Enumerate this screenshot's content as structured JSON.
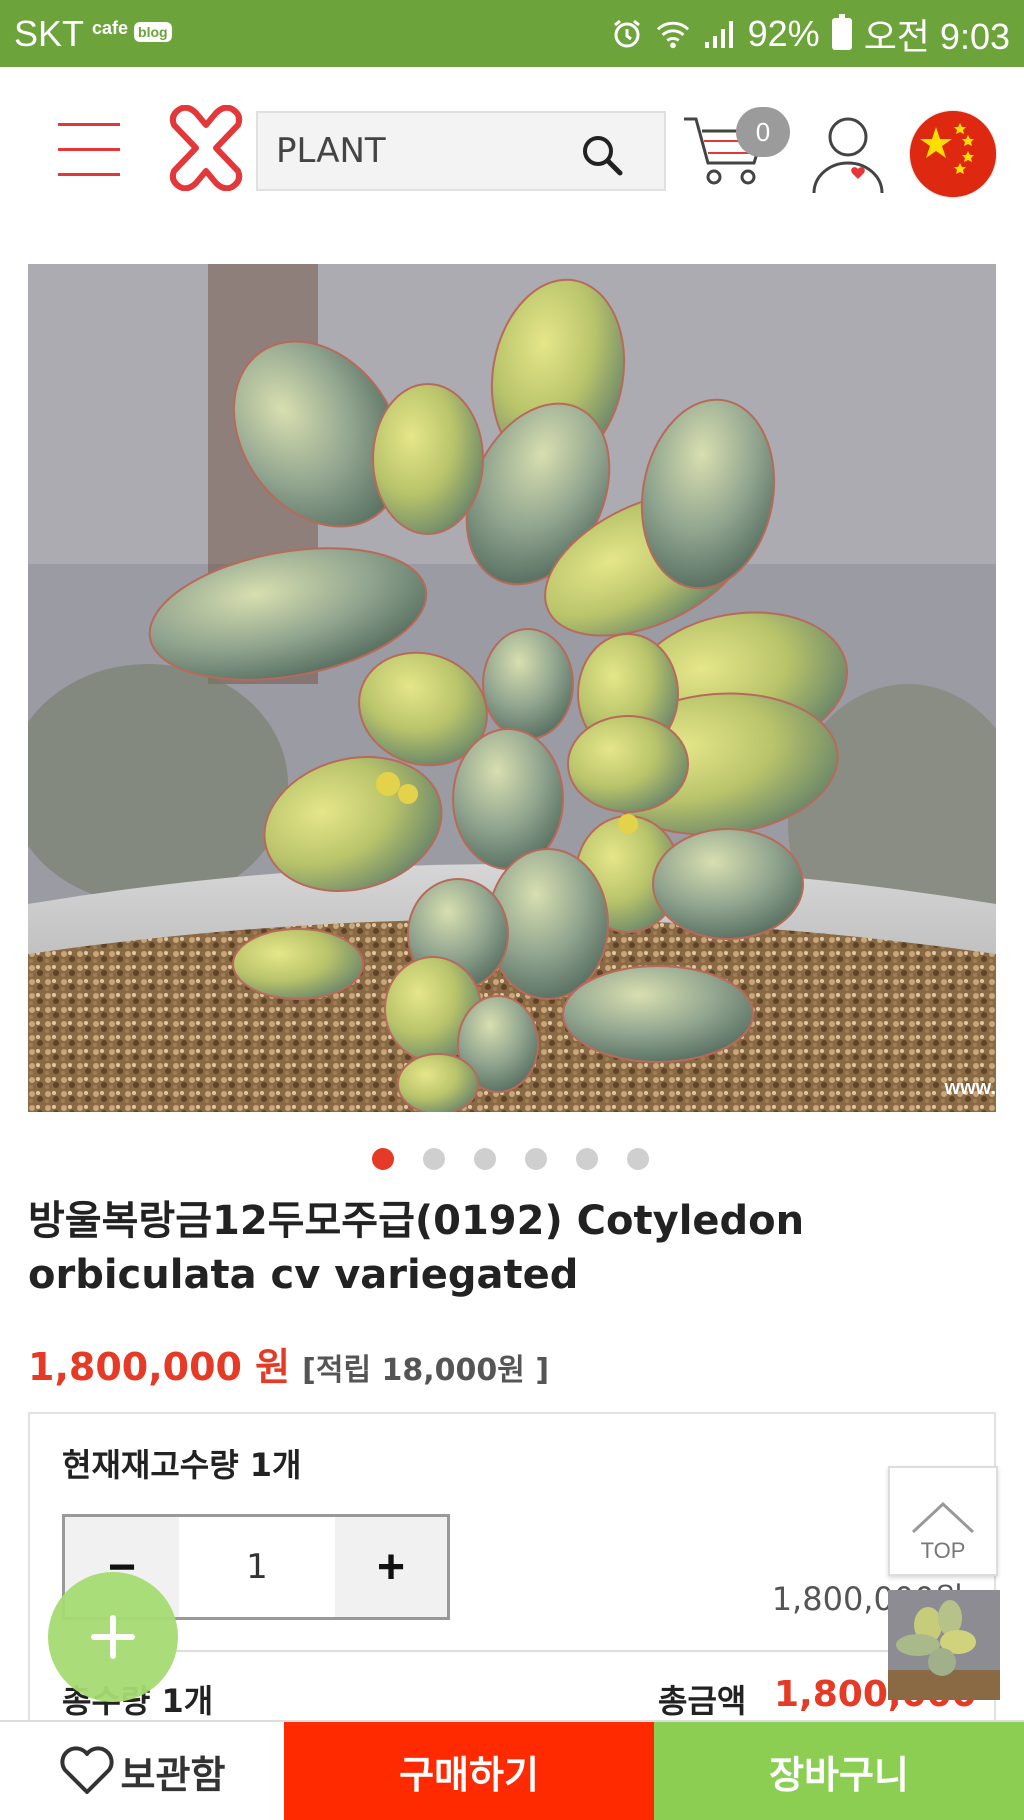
{
  "status_bar": {
    "carrier": "SKT",
    "cafe": "cafe",
    "blog": "blog",
    "battery": "92%",
    "time": "오전 9:03"
  },
  "header": {
    "search_value": "PLANT",
    "cart_count": "0"
  },
  "gallery": {
    "watermark": "www.",
    "dot_count": 6,
    "active_index": 0
  },
  "product": {
    "title": "방울복랑금12두모주급(0192) Cotyledon orbiculata cv variegated",
    "price": "1,800,000 원",
    "points": "[적립 18,000원 ]"
  },
  "order": {
    "stock": "현재재고수량 1개",
    "qty_minus": "−",
    "qty_value": "1",
    "qty_plus": "+",
    "line_total": "1,800,000원",
    "total_qty": "총수량 1개",
    "total_amount_label": "총금액",
    "total_amount": "1,800,000원"
  },
  "floating": {
    "top_label": "TOP"
  },
  "bottom_bar": {
    "wishlist": "보관함",
    "buy": "구매하기",
    "cart": "장바구니"
  },
  "colors": {
    "status_bar": "#6ca33a",
    "accent_red": "#e53a26",
    "buy_button": "#ff2a00",
    "cart_button": "#8bce52"
  }
}
